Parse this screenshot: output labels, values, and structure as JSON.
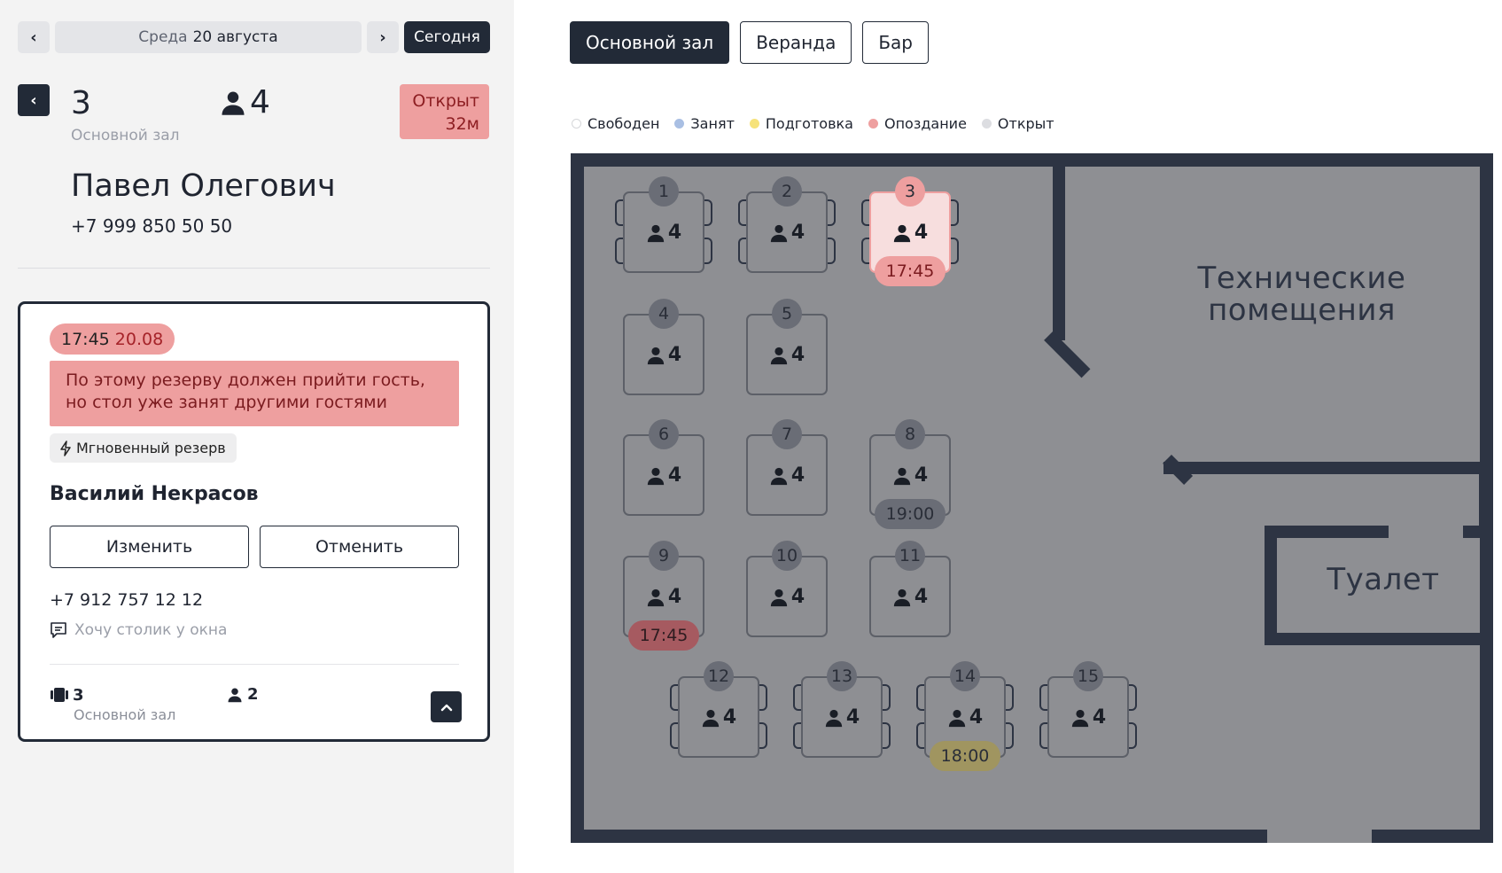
{
  "nav": {
    "weekday": "Среда",
    "date": "20 августа",
    "today_label": "Сегодня"
  },
  "selected_table": {
    "number": "3",
    "hall": "Основной зал",
    "guests": "4",
    "status_line1": "Открыт",
    "status_line2": "32м",
    "guest_name": "Павел Олегович",
    "guest_phone": "+7 999 850 50 50"
  },
  "reservation": {
    "time": "17:45",
    "date": "20.08",
    "alert": "По этому резерву должен прийти гость, но стол уже занят другими гостями",
    "tag": "Мгновенный резерв",
    "name": "Василий Некрасов",
    "edit_label": "Изменить",
    "cancel_label": "Отменить",
    "phone": "+7 912 757 12 12",
    "comment": "Хочу столик у окна",
    "table": "3",
    "hall": "Основной зал",
    "guests": "2"
  },
  "halls": [
    "Основной зал",
    "Веранда",
    "Бар"
  ],
  "legend": [
    {
      "label": "Свободен",
      "color": "#ffffff"
    },
    {
      "label": "Занят",
      "color": "#a9bfe3"
    },
    {
      "label": "Подготовка",
      "color": "#f6e27a"
    },
    {
      "label": "Опоздание",
      "color": "#ee9f9f"
    },
    {
      "label": "Открыт",
      "color": "#dcdde1"
    }
  ],
  "rooms": {
    "tech": "Технические помещения",
    "toilet": "Туалет"
  },
  "tables": [
    {
      "number": "1",
      "seats": "4",
      "chairs": true
    },
    {
      "number": "2",
      "seats": "4",
      "chairs": true
    },
    {
      "number": "3",
      "seats": "4",
      "chairs": true,
      "time": "17:45",
      "state": "late"
    },
    {
      "number": "4",
      "seats": "4"
    },
    {
      "number": "5",
      "seats": "4"
    },
    {
      "number": "6",
      "seats": "4"
    },
    {
      "number": "7",
      "seats": "4"
    },
    {
      "number": "8",
      "seats": "4",
      "time": "19:00",
      "state": "reserved"
    },
    {
      "number": "9",
      "seats": "4",
      "time": "17:45",
      "state": "late-reserved"
    },
    {
      "number": "10",
      "seats": "4"
    },
    {
      "number": "11",
      "seats": "4"
    },
    {
      "number": "12",
      "seats": "4",
      "chairs": true
    },
    {
      "number": "13",
      "seats": "4",
      "chairs": true
    },
    {
      "number": "14",
      "seats": "4",
      "chairs": true,
      "time": "18:00",
      "state": "preparing"
    },
    {
      "number": "15",
      "seats": "4",
      "chairs": true
    }
  ],
  "colors": {
    "dark": "#222a37",
    "late": "#ee9f9f",
    "late_text": "#a52329",
    "floor": "#8e8f93",
    "wall": "#2d3443"
  }
}
